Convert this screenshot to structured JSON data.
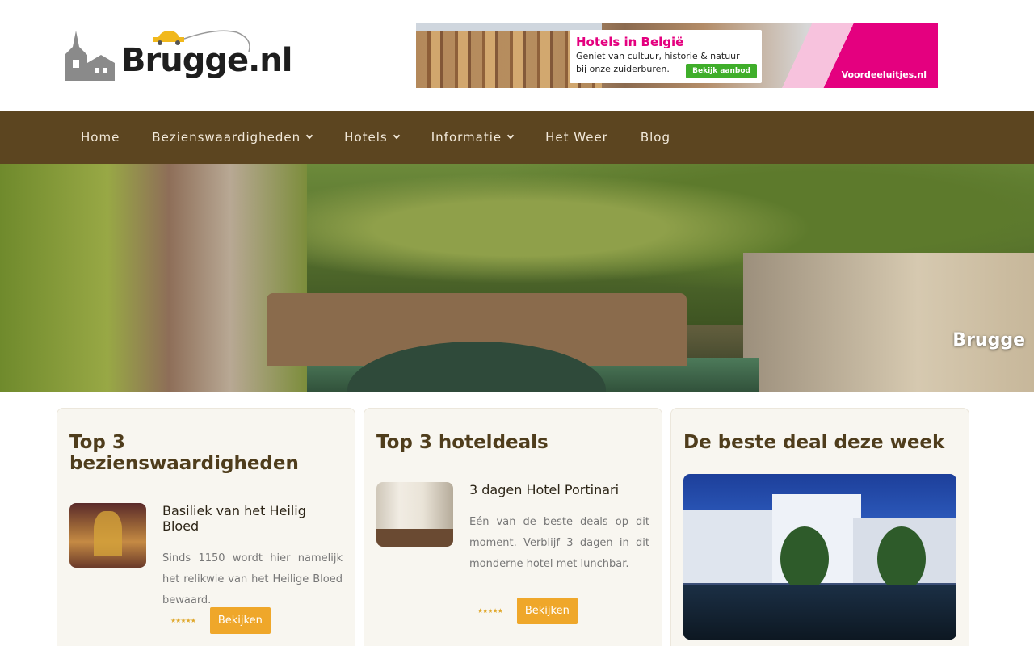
{
  "header": {
    "logo_text": "Brugge.nl",
    "banner": {
      "title": "Hotels in België",
      "line1": "Geniet van cultuur, historie & natuur",
      "line2": "bij onze zuiderburen.",
      "cta": "Bekijk aanbod",
      "brand": "Voordeeluitjes.nl"
    }
  },
  "nav": {
    "items": [
      {
        "label": "Home",
        "dropdown": false
      },
      {
        "label": "Bezienswaardigheden",
        "dropdown": true
      },
      {
        "label": "Hotels",
        "dropdown": true
      },
      {
        "label": "Informatie",
        "dropdown": true
      },
      {
        "label": "Het Weer",
        "dropdown": false
      },
      {
        "label": "Blog",
        "dropdown": false
      }
    ]
  },
  "hero": {
    "caption": "Brugge"
  },
  "cards": {
    "sights": {
      "title": "Top 3 bezienswaardigheden",
      "item": {
        "title": "Basiliek van het Heilig Bloed",
        "desc": "Sinds 1150 wordt hier namelijk het relikwie van het Heilige Bloed bewaard.",
        "stars": "★★★★★",
        "button": "Bekijken"
      }
    },
    "hotels": {
      "title": "Top 3 hoteldeals",
      "item": {
        "title": "3 dagen Hotel Portinari",
        "desc": "Eén van de beste deals op dit moment. Verblijf 3 dagen in dit monderne hotel met lunchbar.",
        "stars": "★★★★★",
        "button": "Bekijken"
      }
    },
    "deal": {
      "title": "De beste deal deze week"
    }
  },
  "colors": {
    "nav_bg": "#5c4520",
    "accent": "#efa72a",
    "heading": "#4f3d1c"
  }
}
